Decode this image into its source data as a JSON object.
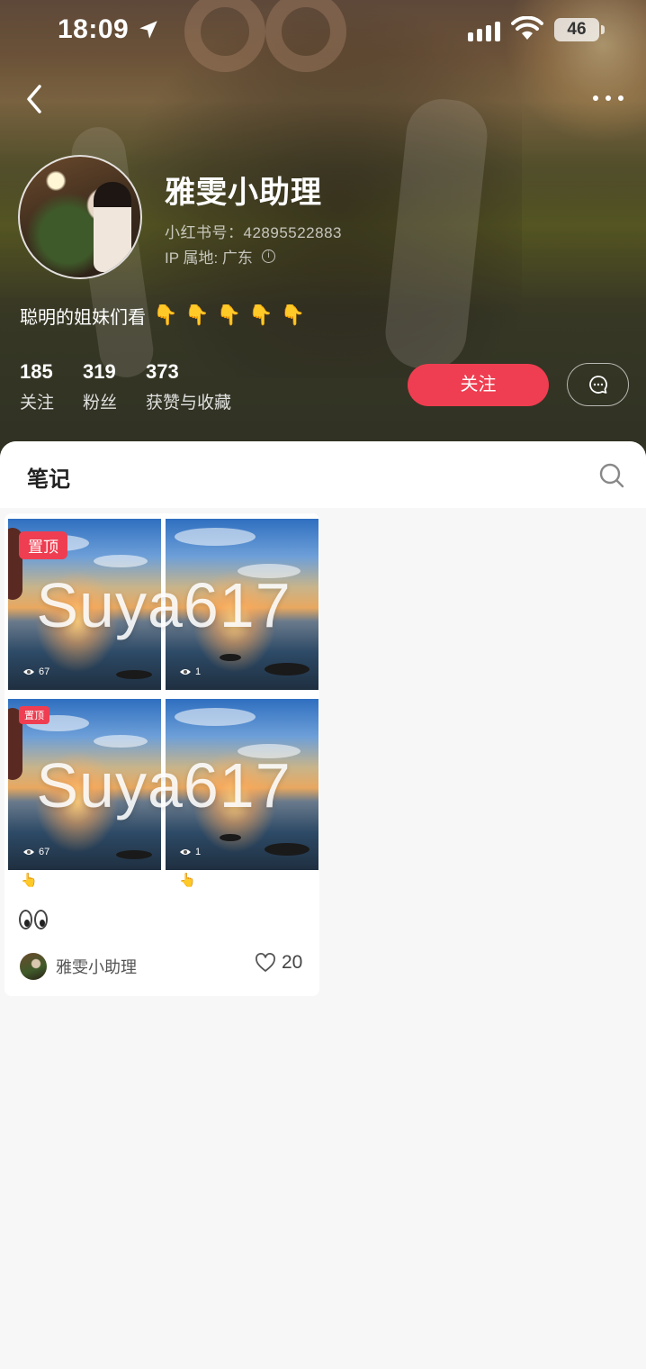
{
  "status_bar": {
    "time": "18:09",
    "battery": "46"
  },
  "profile": {
    "name": "雅雯小助理",
    "id_text": "小红书号：42895522883",
    "ip_text": "IP 属地: 广东",
    "bio": "聪明的姐妹们看",
    "bio_emojis": [
      "👇",
      "👇",
      "👇",
      "👇",
      "👇"
    ]
  },
  "stats": [
    {
      "value": "185",
      "label": "关注"
    },
    {
      "value": "319",
      "label": "粉丝"
    },
    {
      "value": "373",
      "label": "获赞与收藏"
    }
  ],
  "actions": {
    "follow_label": "关注"
  },
  "tabs": {
    "notes_label": "笔记"
  },
  "note": {
    "watermark": "Suya617",
    "pin_label": "置顶",
    "thumb_views": [
      "67",
      "1",
      "67",
      "1"
    ],
    "author": "雅雯小助理",
    "likes": "20"
  },
  "icons": [
    "location-arrow-icon",
    "signal-icon",
    "wifi-icon",
    "battery-icon",
    "back-icon",
    "more-icon",
    "info-icon",
    "chat-icon",
    "search-icon",
    "eye-icon",
    "heart-icon"
  ],
  "colors": {
    "accent": "#ef3e51",
    "background": "#f7f7f7"
  }
}
